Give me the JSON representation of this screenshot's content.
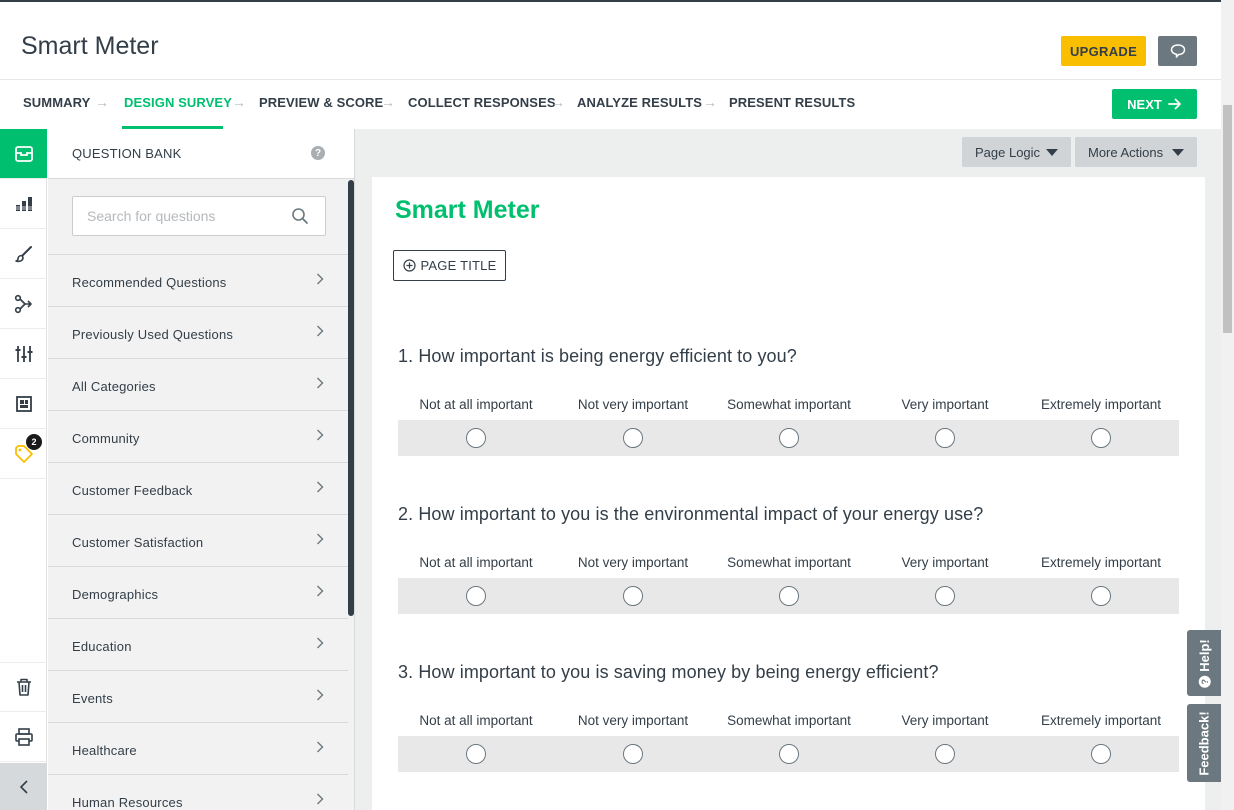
{
  "header": {
    "survey_title": "Smart Meter",
    "upgrade_label": "UPGRADE"
  },
  "steps": [
    {
      "label": "SUMMARY"
    },
    {
      "label": "DESIGN SURVEY"
    },
    {
      "label": "PREVIEW & SCORE"
    },
    {
      "label": "COLLECT RESPONSES"
    },
    {
      "label": "ANALYZE RESULTS"
    },
    {
      "label": "PRESENT RESULTS"
    }
  ],
  "next_label": "NEXT",
  "rail": {
    "badge_count": "2",
    "icons": [
      "question-bank-icon",
      "builder-icon",
      "design-icon",
      "logic-icon",
      "options-icon",
      "library-icon",
      "tag-icon",
      "trash-icon",
      "print-icon",
      "collapse-icon"
    ]
  },
  "question_bank": {
    "title": "QUESTION BANK",
    "help": "?",
    "search_placeholder": "Search for questions",
    "categories": [
      "Recommended Questions",
      "Previously Used Questions",
      "All Categories",
      "Community",
      "Customer Feedback",
      "Customer Satisfaction",
      "Demographics",
      "Education",
      "Events",
      "Healthcare",
      "Human Resources"
    ]
  },
  "toolbar": {
    "page_logic": "Page Logic",
    "more_actions": "More Actions"
  },
  "survey": {
    "heading": "Smart Meter",
    "page_title_button": "PAGE TITLE",
    "scale": [
      "Not at all important",
      "Not very important",
      "Somewhat important",
      "Very important",
      "Extremely important"
    ],
    "questions": [
      "1. How important is being energy efficient to you?",
      "2. How important to you is the environmental impact of your energy use?",
      "3. How important to you is saving money by being energy efficient?"
    ]
  },
  "side_tabs": {
    "help": "Help!",
    "feedback": "Feedback!"
  },
  "colors": {
    "brand_green": "#00bf6f",
    "upgrade_yellow": "#f9be00",
    "text_dark": "#333e48",
    "slate": "#6b787f"
  }
}
